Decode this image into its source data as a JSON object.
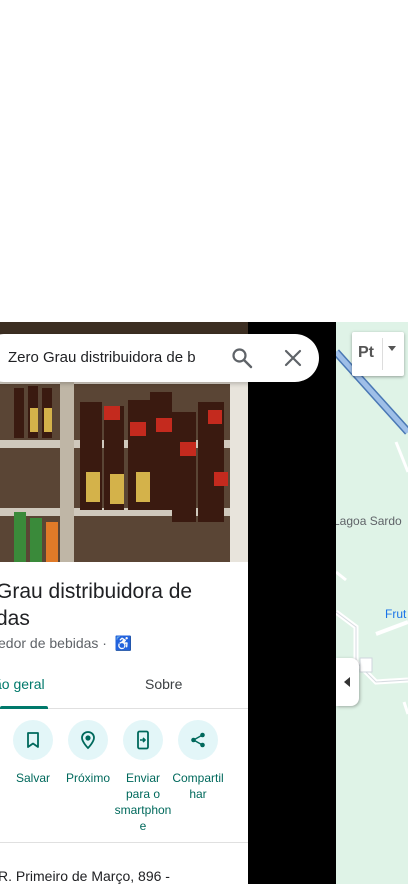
{
  "search": {
    "value": "Zero Grau distribuidora de bebidas"
  },
  "place": {
    "title_line1": "Grau distribuidora de",
    "title_line2": "das",
    "subtitle": "edor de bebidas ·",
    "accessibility_icon": "wheelchair-icon"
  },
  "tabs": [
    {
      "label": "ão geral",
      "active": true
    },
    {
      "label": "Sobre",
      "active": false
    }
  ],
  "actions": [
    {
      "label": "Salvar",
      "icon": "bookmark-icon"
    },
    {
      "label": "Próximo",
      "icon": "nearby-icon"
    },
    {
      "label": "Enviar para o smartphone",
      "icon": "send-to-phone-icon"
    },
    {
      "label": "Compartilhar",
      "icon": "share-icon"
    }
  ],
  "address": "R. Primeiro de Março, 896 -",
  "map": {
    "label_lagoa": "Lagoa Sardo",
    "label_fru": "Frut",
    "layer_button_text": "Pt"
  },
  "colors": {
    "accent": "#00796b",
    "action_circle": "#e3f6f8",
    "map_bg": "#dff3e7"
  }
}
